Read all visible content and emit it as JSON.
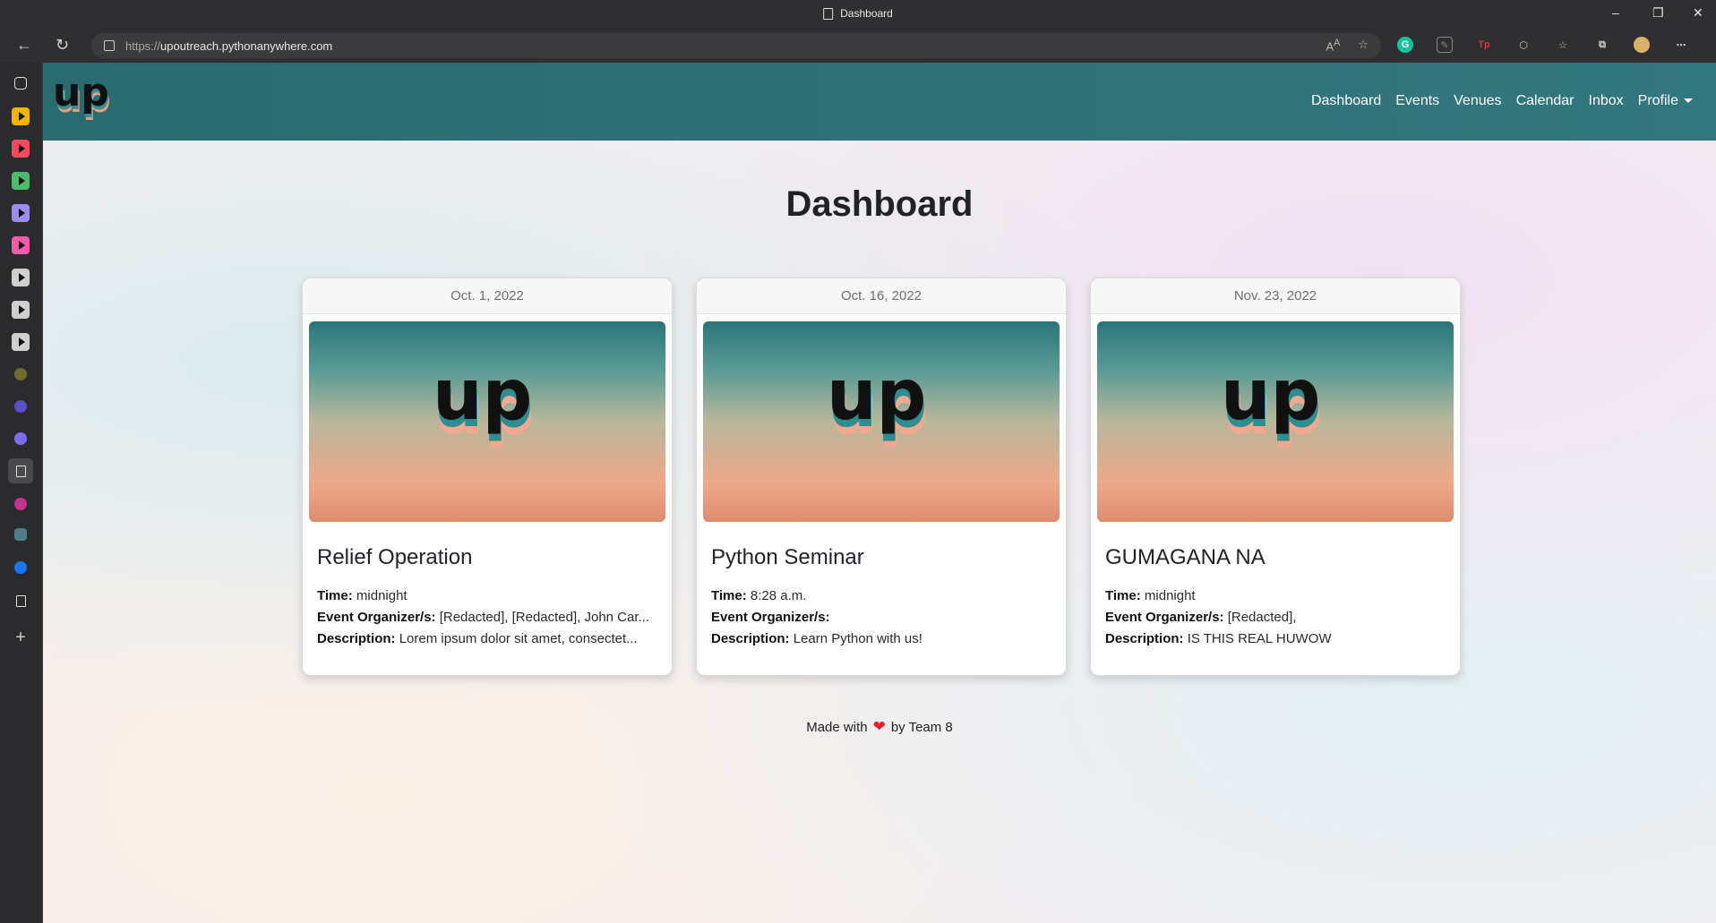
{
  "browser": {
    "tab_title": "Dashboard",
    "url_scheme": "https://",
    "url_host": "upoutreach.pythonanywhere.com",
    "window_controls": [
      "–",
      "❐",
      "✕"
    ]
  },
  "nav": {
    "links": [
      "Dashboard",
      "Events",
      "Venues",
      "Calendar",
      "Inbox",
      "Profile"
    ]
  },
  "page": {
    "title": "Dashboard"
  },
  "events": [
    {
      "date": "Oct. 1, 2022",
      "name": "Relief Operation",
      "time_label": "Time:",
      "time": "midnight",
      "organizer_label": "Event Organizer/s:",
      "organizers": "[Redacted], [Redacted], John Car...",
      "description_label": "Description:",
      "description": "Lorem ipsum dolor sit amet, consectet..."
    },
    {
      "date": "Oct. 16, 2022",
      "name": "Python Seminar",
      "time_label": "Time:",
      "time": "8:28 a.m.",
      "organizer_label": "Event Organizer/s:",
      "organizers": "",
      "description_label": "Description:",
      "description": "Learn Python with us!"
    },
    {
      "date": "Nov. 23, 2022",
      "name": "GUMAGANA NA",
      "time_label": "Time:",
      "time": "midnight",
      "organizer_label": "Event Organizer/s:",
      "organizers": "[Redacted],",
      "description_label": "Description:",
      "description": "IS THIS REAL HUWOW"
    }
  ],
  "footer": {
    "made_with": "Made with",
    "by": "by Team 8"
  },
  "colors": {
    "navbar": "#2a6b70",
    "heart": "#e0252f"
  }
}
